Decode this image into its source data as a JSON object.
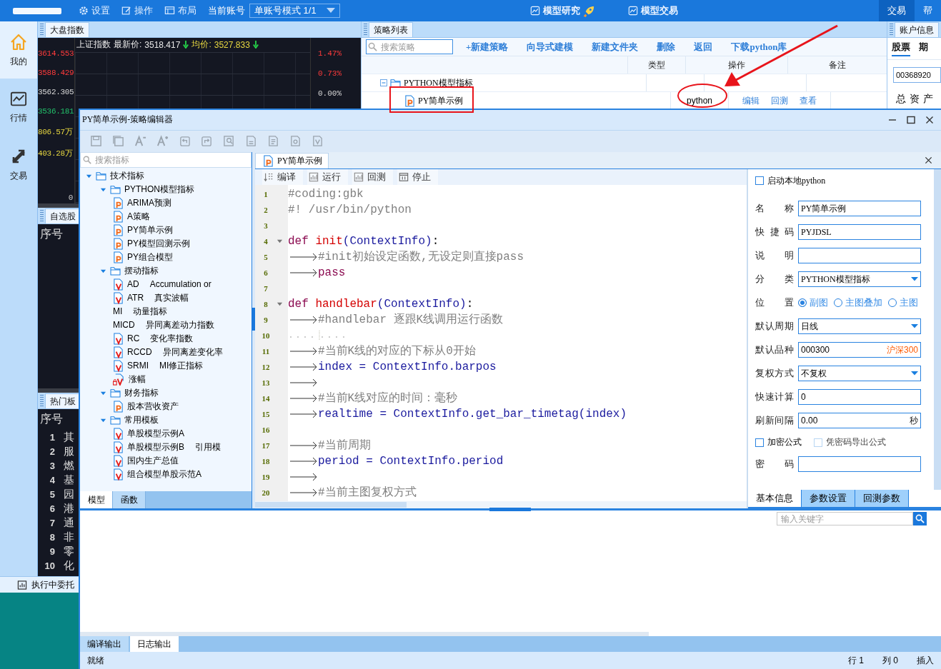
{
  "top_bar": {
    "menu": [
      {
        "label": "设置"
      },
      {
        "label": "操作"
      },
      {
        "label": "布局"
      }
    ],
    "account_label": "当前账号",
    "account_mode": "单账号模式 1/1",
    "center_tabs": [
      {
        "label": "模型研究"
      },
      {
        "label": "模型交易"
      }
    ],
    "right_buttons": [
      {
        "label": "交易",
        "selected": true
      },
      {
        "label": "帮",
        "selected": false
      }
    ]
  },
  "sidebar": {
    "items": [
      {
        "label": "我的",
        "selected": true
      },
      {
        "label": "行情",
        "selected": false
      },
      {
        "label": "交易",
        "selected": false
      }
    ],
    "pending_orders": "执行中委托"
  },
  "market_panel": {
    "tab": "大盘指数",
    "header": {
      "name": "上证指数",
      "latest_label": "最新价:",
      "latest": "3518.417",
      "avg_label": "均价:",
      "avg": "3527.833"
    },
    "left_axis": [
      {
        "text": "3614.553",
        "color": "#ff3b3b"
      },
      {
        "text": "3588.429",
        "color": "#ff3b3b"
      },
      {
        "text": "3562.305",
        "color": "#d8d8d8"
      },
      {
        "text": "3536.181",
        "color": "#22c06a"
      },
      {
        "text": "806.57万",
        "color": "#e6d640"
      },
      {
        "text": "403.28万",
        "color": "#e6d640"
      }
    ],
    "right_axis": [
      {
        "text": "1.47%",
        "color": "#ff3b3b"
      },
      {
        "text": "0.73%",
        "color": "#ff3b3b"
      },
      {
        "text": "0.00%",
        "color": "#d8d8d8"
      }
    ],
    "volume_zero": "0"
  },
  "watchlist": {
    "tab": "自选股",
    "column": "序号"
  },
  "hot_sectors": {
    "tab": "热门板",
    "column": "序号",
    "rows": [
      {
        "rank": "1",
        "name": "其"
      },
      {
        "rank": "2",
        "name": "服"
      },
      {
        "rank": "3",
        "name": "燃"
      },
      {
        "rank": "4",
        "name": "基"
      },
      {
        "rank": "5",
        "name": "园"
      },
      {
        "rank": "6",
        "name": "港"
      },
      {
        "rank": "7",
        "name": "通"
      },
      {
        "rank": "8",
        "name": "非"
      },
      {
        "rank": "9",
        "name": "零"
      },
      {
        "rank": "10",
        "name": "化"
      }
    ]
  },
  "strategy_panel": {
    "tab": "策略列表",
    "search": {
      "placeholder": "搜索策略"
    },
    "actions": [
      "+新建策略",
      "向导式建模",
      "新建文件夹",
      "删除",
      "返回",
      "下载python库"
    ],
    "columns": [
      "类型",
      "操作",
      "备注"
    ],
    "tree": [
      {
        "kind": "folder",
        "label": "PYTHON模型指标",
        "expanded": true,
        "children": [
          {
            "kind": "py",
            "label": "PY简单示例",
            "type": "python",
            "actions": [
              "编辑",
              "回测",
              "查看"
            ]
          }
        ]
      }
    ]
  },
  "account_panel": {
    "tab": "账户信息",
    "tabs": [
      {
        "label": "股票",
        "selected": true
      },
      {
        "label": "期",
        "selected": false
      }
    ],
    "account": "00368920",
    "total_assets": "总资产"
  },
  "editor": {
    "title": "PY简单示例-策略编辑器",
    "toolbar": [
      {
        "kind": "save"
      },
      {
        "kind": "save_all"
      },
      {
        "kind": "font_smaller"
      },
      {
        "kind": "font_larger"
      },
      {
        "kind": "undo"
      },
      {
        "kind": "redo"
      },
      {
        "kind": "find"
      },
      {
        "kind": "export"
      },
      {
        "kind": "import"
      },
      {
        "kind": "settings"
      },
      {
        "kind": "format"
      }
    ],
    "indicator_search": {
      "placeholder": "搜索指标"
    },
    "tree": [
      {
        "kind": "folder",
        "label": "技术指标",
        "expanded": true,
        "children": [
          {
            "kind": "folder",
            "label": "PYTHON模型指标",
            "expanded": true,
            "children": [
              {
                "kind": "py",
                "label": "ARIMA预测"
              },
              {
                "kind": "py",
                "label": "A策略"
              },
              {
                "kind": "py",
                "label": "PY简单示例"
              },
              {
                "kind": "py",
                "label": "PY模型回测示例"
              },
              {
                "kind": "py",
                "label": "PY组合模型"
              }
            ]
          },
          {
            "kind": "folder",
            "label": "摆动指标",
            "expanded": true,
            "children": [
              {
                "kind": "formula",
                "label": "AD",
                "note": "Accumulation or"
              },
              {
                "kind": "formula",
                "label": "ATR",
                "note": "真实波幅"
              },
              {
                "kind": "plain",
                "label": "MI",
                "note": "动量指标"
              },
              {
                "kind": "plain",
                "label": "MICD",
                "note": "异同离差动力指数"
              },
              {
                "kind": "formula",
                "label": "RC",
                "note": "变化率指数"
              },
              {
                "kind": "formula",
                "label": "RCCD",
                "note": "异同离差变化率"
              },
              {
                "kind": "formula",
                "label": "SRMI",
                "note": "MI修正指标"
              },
              {
                "kind": "locked",
                "label": "涨幅"
              }
            ]
          },
          {
            "kind": "folder",
            "label": "财务指标",
            "expanded": true,
            "children": [
              {
                "kind": "py",
                "label": "股本营收资产"
              }
            ]
          },
          {
            "kind": "folder",
            "label": "常用模板",
            "expanded": true,
            "children": [
              {
                "kind": "formula",
                "label": "单股模型示例A"
              },
              {
                "kind": "formula",
                "label": "单股模型示例B",
                "note": "引用模"
              },
              {
                "kind": "formula",
                "label": "国内生产总值"
              },
              {
                "kind": "formula",
                "label": "组合模型单股示范A"
              }
            ]
          }
        ]
      }
    ],
    "left_tabs": [
      {
        "label": "模型",
        "selected": true
      },
      {
        "label": "函数",
        "selected": false
      }
    ],
    "file_tab": "PY简单示例",
    "code_toolbar": [
      {
        "label": "编译"
      },
      {
        "label": "运行"
      },
      {
        "label": "回测"
      },
      {
        "label": "停止"
      }
    ],
    "code": [
      {
        "number": "1",
        "tab": false,
        "fold": false,
        "tokens": [
          {
            "kind": "comment",
            "text": "#coding:gbk"
          }
        ]
      },
      {
        "number": "2",
        "tab": false,
        "fold": false,
        "tokens": [
          {
            "kind": "comment",
            "text": "#! /usr/bin/python"
          }
        ]
      },
      {
        "number": "3",
        "tab": false,
        "fold": false
      },
      {
        "number": "4",
        "tab": false,
        "fold": true,
        "tokens": [
          {
            "kind": "keyword",
            "text": "def "
          },
          {
            "kind": "name",
            "text": "init"
          },
          {
            "kind": "ident",
            "text": "(ContextInfo)"
          },
          {
            "kind": "punct",
            "text": ":"
          }
        ]
      },
      {
        "number": "5",
        "tab": true,
        "fold": false,
        "tokens": [
          {
            "kind": "comment",
            "text": "#init初始设定函数,无设定则直接pass"
          }
        ]
      },
      {
        "number": "6",
        "tab": true,
        "fold": false,
        "tokens": [
          {
            "kind": "keyword",
            "text": "pass"
          }
        ]
      },
      {
        "number": "7",
        "tab": false,
        "fold": false
      },
      {
        "number": "8",
        "tab": false,
        "fold": true,
        "tokens": [
          {
            "kind": "keyword",
            "text": "def "
          },
          {
            "kind": "name",
            "text": "handlebar"
          },
          {
            "kind": "ident",
            "text": "(ContextInfo)"
          },
          {
            "kind": "punct",
            "text": ":"
          }
        ]
      },
      {
        "number": "9",
        "tab": true,
        "fold": false,
        "tokens": [
          {
            "kind": "comment",
            "text": "#handlebar 逐跟K线调用运行函数"
          }
        ]
      },
      {
        "number": "10",
        "tab": false,
        "fold": false,
        "whitespace": true
      },
      {
        "number": "11",
        "tab": true,
        "fold": false,
        "tokens": [
          {
            "kind": "comment",
            "text": "#当前K线的对应的下标从0开始"
          }
        ]
      },
      {
        "number": "12",
        "tab": true,
        "fold": false,
        "tokens": [
          {
            "kind": "ident",
            "text": "index = ContextInfo.barpos"
          }
        ]
      },
      {
        "number": "13",
        "tab": true,
        "fold": false
      },
      {
        "number": "14",
        "tab": true,
        "fold": false,
        "tokens": [
          {
            "kind": "comment",
            "text": "#当前K线对应的时间：毫秒"
          }
        ]
      },
      {
        "number": "15",
        "tab": true,
        "fold": false,
        "tokens": [
          {
            "kind": "ident",
            "text": "realtime = ContextInfo.get_bar_timetag(index)"
          }
        ]
      },
      {
        "number": "16",
        "tab": false,
        "fold": false
      },
      {
        "number": "17",
        "tab": true,
        "fold": false,
        "tokens": [
          {
            "kind": "comment",
            "text": "#当前周期"
          }
        ]
      },
      {
        "number": "18",
        "tab": true,
        "fold": false,
        "tokens": [
          {
            "kind": "ident",
            "text": "period = ContextInfo.period"
          }
        ]
      },
      {
        "number": "19",
        "tab": true,
        "fold": false
      },
      {
        "number": "20",
        "tab": true,
        "fold": false,
        "tokens": [
          {
            "kind": "comment",
            "text": "#当前主图复权方式"
          }
        ]
      }
    ],
    "properties": {
      "local_python": {
        "label": "启动本地python",
        "checked": false
      },
      "rows": [
        {
          "kind": "text",
          "label": "名称",
          "value": "PY简单示例"
        },
        {
          "kind": "text",
          "label": "快捷码",
          "value": "PYJDSL"
        },
        {
          "kind": "text",
          "label": "说明"
        },
        {
          "kind": "dropdown",
          "label": "分类",
          "value": "PYTHON模型指标"
        },
        {
          "kind": "radio",
          "label": "位置",
          "options": [
            {
              "label": "副图",
              "selected": true
            },
            {
              "label": "主图叠加",
              "selected": false
            },
            {
              "label": "主图",
              "selected": false
            }
          ]
        },
        {
          "kind": "dropdown",
          "label": "默认周期",
          "value": "日线"
        },
        {
          "kind": "text",
          "label": "默认品种",
          "value": "000300",
          "suffix": {
            "text": "沪深300",
            "color": "#ff5a00"
          }
        },
        {
          "kind": "dropdown",
          "label": "复权方式",
          "value": "不复权"
        },
        {
          "kind": "text",
          "label": "快速计算",
          "value": "0"
        },
        {
          "kind": "text",
          "label": "刷新间隔",
          "value": "0.00",
          "suffix": {
            "text": "秒",
            "color": "#222222"
          }
        },
        {
          "kind": "checks",
          "options": [
            {
              "label": "加密公式",
              "checked": false,
              "disabled": false
            },
            {
              "label": "凭密码导出公式",
              "checked": false,
              "disabled": true
            }
          ]
        },
        {
          "kind": "text",
          "label": "密码"
        }
      ],
      "tabs": [
        {
          "label": "基本信息",
          "selected": true
        },
        {
          "label": "参数设置",
          "selected": false
        },
        {
          "label": "回测参数",
          "selected": false
        }
      ]
    },
    "output": {
      "search": {
        "placeholder": "输入关键字"
      },
      "tabs": [
        {
          "label": "编译输出",
          "selected": false
        },
        {
          "label": "日志输出",
          "selected": true
        }
      ]
    },
    "status_bar": {
      "state": "就绪",
      "line": "行 1",
      "column": "列 0",
      "mode": "插入"
    }
  }
}
